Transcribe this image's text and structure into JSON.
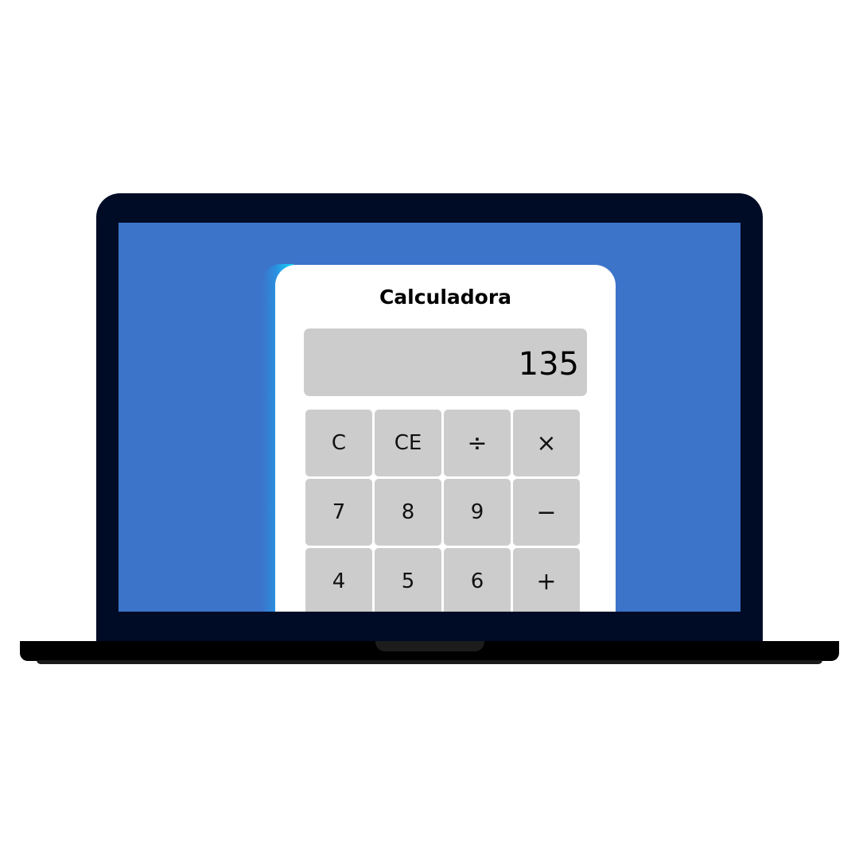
{
  "calculator": {
    "title": "Calculadora",
    "display_value": "135",
    "keys": [
      {
        "label": "C",
        "name": "clear-button"
      },
      {
        "label": "CE",
        "name": "clear-entry-button"
      },
      {
        "label": "÷",
        "name": "divide-button"
      },
      {
        "label": "×",
        "name": "multiply-button"
      },
      {
        "label": "7",
        "name": "digit-7-button"
      },
      {
        "label": "8",
        "name": "digit-8-button"
      },
      {
        "label": "9",
        "name": "digit-9-button"
      },
      {
        "label": "−",
        "name": "subtract-button"
      },
      {
        "label": "4",
        "name": "digit-4-button"
      },
      {
        "label": "5",
        "name": "digit-5-button"
      },
      {
        "label": "6",
        "name": "digit-6-button"
      },
      {
        "label": "+",
        "name": "add-button"
      }
    ]
  },
  "colors": {
    "screen_background": "#3c74c9",
    "laptop_frame": "#000c26",
    "key_background": "#cccccc",
    "display_background": "#cccccc",
    "card_background": "#ffffff",
    "accent_gradient_edge": "#14d6fb"
  }
}
